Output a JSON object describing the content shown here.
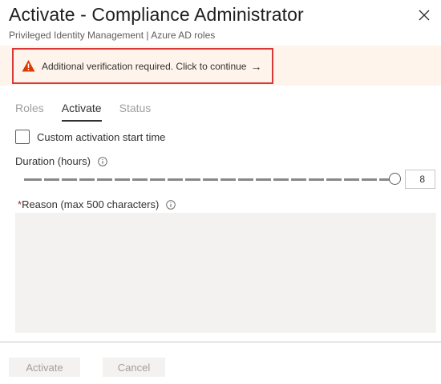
{
  "header": {
    "title": "Activate - Compliance Administrator",
    "subtitle": "Privileged Identity Management | Azure AD roles",
    "close_icon": "close-icon"
  },
  "banner": {
    "icon": "warning-icon",
    "text": "Additional verification required. Click to continue",
    "arrow": "→",
    "colors": {
      "background": "#fff4ec",
      "highlight_border": "#d9383b",
      "icon": "#d83b01"
    }
  },
  "tabs": [
    {
      "label": "Roles",
      "active": false
    },
    {
      "label": "Activate",
      "active": true
    },
    {
      "label": "Status",
      "active": false
    }
  ],
  "form": {
    "custom_start": {
      "label": "Custom activation start time",
      "checked": false
    },
    "duration": {
      "label": "Duration (hours)",
      "info_icon": "info-icon",
      "value": "8",
      "max": 8
    },
    "reason": {
      "required_mark": "*",
      "label": "Reason (max 500 characters)",
      "info_icon": "info-icon",
      "value": ""
    }
  },
  "footer": {
    "activate_label": "Activate",
    "cancel_label": "Cancel"
  }
}
